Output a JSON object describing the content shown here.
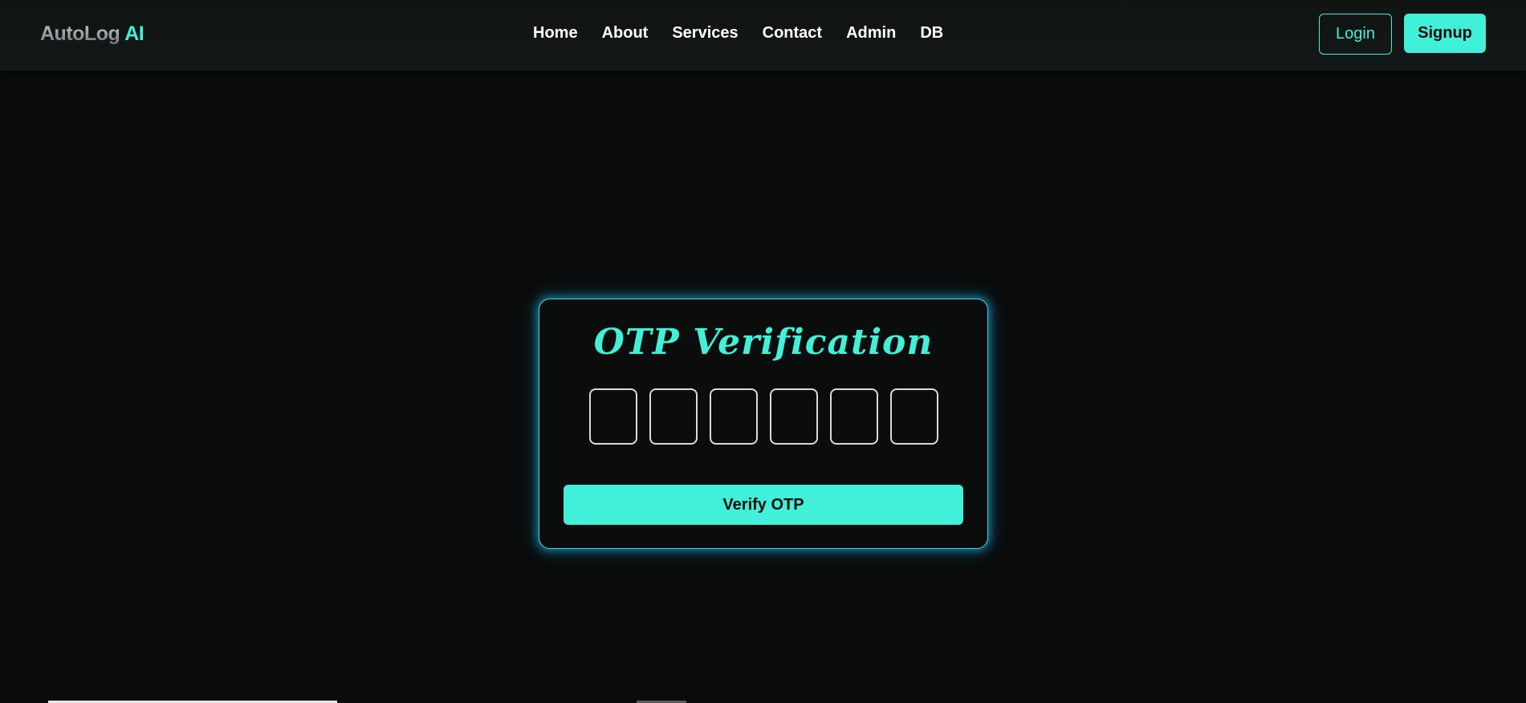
{
  "header": {
    "logo_main": "AutoLog",
    "logo_accent": "AI",
    "nav": [
      "Home",
      "About",
      "Services",
      "Contact",
      "Admin",
      "DB"
    ],
    "login_label": "Login",
    "signup_label": "Signup"
  },
  "otp": {
    "title": "OTP Verification",
    "digits": [
      "",
      "",
      "",
      "",
      "",
      ""
    ],
    "verify_label": "Verify OTP"
  },
  "colors": {
    "accent": "#41f0d8",
    "background": "#0a0b0b",
    "card_glow": "#3fd6e0"
  }
}
